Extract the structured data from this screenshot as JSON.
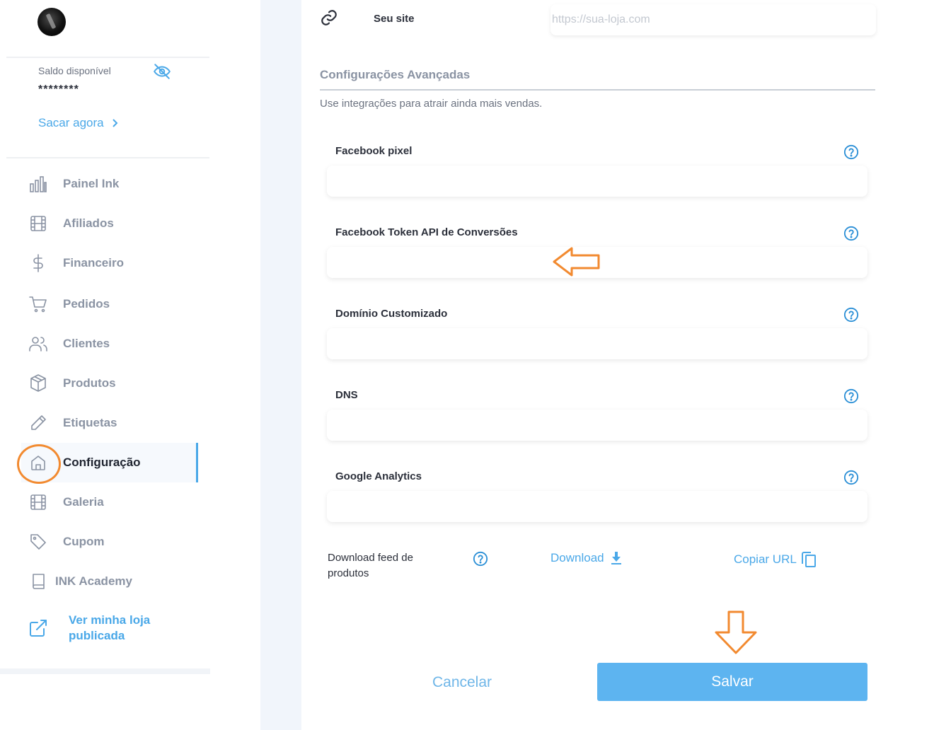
{
  "sidebar": {
    "balance_label": "Saldo disponível",
    "balance_value": "********",
    "withdraw_label": "Sacar agora",
    "items": [
      {
        "label": "Painel Ink",
        "icon": "bar-chart-icon"
      },
      {
        "label": "Afiliados",
        "icon": "film-icon"
      },
      {
        "label": "Financeiro",
        "icon": "dollar-icon"
      },
      {
        "label": "Pedidos",
        "icon": "cart-icon"
      },
      {
        "label": "Clientes",
        "icon": "users-icon"
      },
      {
        "label": "Produtos",
        "icon": "box-icon"
      },
      {
        "label": "Etiquetas",
        "icon": "pencil-icon"
      },
      {
        "label": "Configuração",
        "icon": "home-icon",
        "active": true
      },
      {
        "label": "Galeria",
        "icon": "film-icon"
      },
      {
        "label": "Cupom",
        "icon": "tag-icon"
      },
      {
        "label": "INK Academy",
        "icon": "book-icon"
      },
      {
        "label": "Ver minha loja publicada",
        "icon": "external-link-icon"
      }
    ]
  },
  "site": {
    "label": "Seu site",
    "placeholder": "https://sua-loja.com"
  },
  "advanced": {
    "title": "Configurações Avançadas",
    "subtitle": "Use integrações para atrair ainda mais vendas.",
    "fields": [
      {
        "label": "Facebook pixel",
        "value": ""
      },
      {
        "label": "Facebook Token API de Conversões",
        "value": ""
      },
      {
        "label": "Domínio Customizado",
        "value": ""
      },
      {
        "label": "DNS",
        "value": ""
      },
      {
        "label": "Google Analytics",
        "value": ""
      }
    ]
  },
  "feed": {
    "label": "Download feed de produtos",
    "download_label": "Download",
    "copy_label": "Copiar URL"
  },
  "actions": {
    "cancel_label": "Cancelar",
    "save_label": "Salvar"
  },
  "colors": {
    "accent": "#4aa8e8",
    "save_button": "#5db4f0",
    "annotation": "#f28a30"
  }
}
